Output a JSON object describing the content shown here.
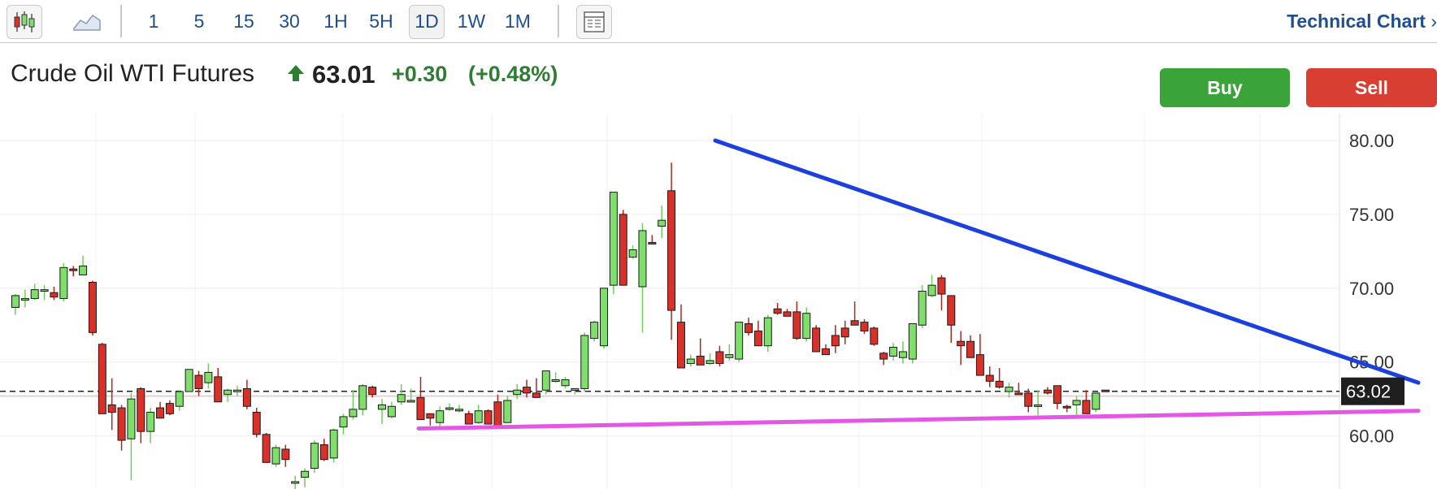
{
  "toolbar": {
    "timeframes": [
      "1",
      "5",
      "15",
      "30",
      "1H",
      "5H",
      "1D",
      "1W",
      "1M"
    ],
    "active_timeframe": "1D",
    "technical_chart_label": "Technical Chart",
    "chevron": "›",
    "icons": [
      "candlestick-icon",
      "area-chart-icon",
      "layout-icon"
    ]
  },
  "instrument": {
    "name": "Crude Oil WTI Futures",
    "direction": "up-arrow-icon",
    "price": "63.01",
    "change": "+0.30",
    "change_pct": "(+0.48%)"
  },
  "actions": {
    "buy_label": "Buy",
    "sell_label": "Sell"
  },
  "colors": {
    "up": "#7fdf6a",
    "down": "#d8312a",
    "buy": "#3aa339",
    "sell": "#d93e32",
    "link": "#1f4f91",
    "resistance": "#1c3fe0",
    "support": "#e456e6"
  },
  "chart_data": {
    "type": "candlestick",
    "title": "Crude Oil WTI Futures",
    "ylim": [
      57.5,
      80.6
    ],
    "yticks": [
      "80.00",
      "75.00",
      "70.00",
      "65.00",
      "60.00"
    ],
    "last_price_label": "63.02",
    "last_price": 63.02,
    "ohlc": [
      [
        68.7,
        69.6,
        68.2,
        69.5
      ],
      [
        69.3,
        69.9,
        68.7,
        69.3
      ],
      [
        69.3,
        70.3,
        69.2,
        69.9
      ],
      [
        69.8,
        70.2,
        69.2,
        69.9
      ],
      [
        69.7,
        70.1,
        69.2,
        69.4
      ],
      [
        69.3,
        71.7,
        69.1,
        71.4
      ],
      [
        71.3,
        71.5,
        70.8,
        71.2
      ],
      [
        70.9,
        72.2,
        70.9,
        71.5
      ],
      [
        70.4,
        70.5,
        66.8,
        67.0
      ],
      [
        66.2,
        66.3,
        61.7,
        61.5
      ],
      [
        62.1,
        63.9,
        60.4,
        61.6
      ],
      [
        61.9,
        62.1,
        59.0,
        59.7
      ],
      [
        59.8,
        62.9,
        57.0,
        62.5
      ],
      [
        63.2,
        63.3,
        59.5,
        60.3
      ],
      [
        60.3,
        61.9,
        59.5,
        61.6
      ],
      [
        61.9,
        62.3,
        61.2,
        61.2
      ],
      [
        62.2,
        62.4,
        61.4,
        61.5
      ],
      [
        62.0,
        63.1,
        61.7,
        63.0
      ],
      [
        63.0,
        64.4,
        63.0,
        64.5
      ],
      [
        64.1,
        64.4,
        62.7,
        63.2
      ],
      [
        63.6,
        64.9,
        63.2,
        64.3
      ],
      [
        64.0,
        64.6,
        62.3,
        62.3
      ],
      [
        62.8,
        63.2,
        62.3,
        63.1
      ],
      [
        63.0,
        63.4,
        62.7,
        63.1
      ],
      [
        63.2,
        63.8,
        61.8,
        62.0
      ],
      [
        61.6,
        61.9,
        59.9,
        60.1
      ],
      [
        60.1,
        60.2,
        58.3,
        58.2
      ],
      [
        58.1,
        59.4,
        57.9,
        59.2
      ],
      [
        59.1,
        59.4,
        57.9,
        58.4
      ],
      [
        56.8,
        57.3,
        56.3,
        56.9
      ],
      [
        57.2,
        57.8,
        56.5,
        57.6
      ],
      [
        57.8,
        59.7,
        57.5,
        59.5
      ],
      [
        59.4,
        59.8,
        58.3,
        58.4
      ],
      [
        58.5,
        60.5,
        58.2,
        60.4
      ],
      [
        60.6,
        61.5,
        60.1,
        61.3
      ],
      [
        61.3,
        63.1,
        61.1,
        61.8
      ],
      [
        61.8,
        63.5,
        61.4,
        63.4
      ],
      [
        63.3,
        63.4,
        62.6,
        62.8
      ],
      [
        61.8,
        62.5,
        60.8,
        62.1
      ],
      [
        61.3,
        62.3,
        61.2,
        62.0
      ],
      [
        62.3,
        63.5,
        62.1,
        62.8
      ],
      [
        62.4,
        63.2,
        62.3,
        62.4
      ],
      [
        62.6,
        64.0,
        61.7,
        61.1
      ],
      [
        61.5,
        61.5,
        60.7,
        61.2
      ],
      [
        60.9,
        62.0,
        60.6,
        61.7
      ],
      [
        61.8,
        62.2,
        61.7,
        61.9
      ],
      [
        61.8,
        62.1,
        61.6,
        61.8
      ],
      [
        61.5,
        61.7,
        60.8,
        60.8
      ],
      [
        60.9,
        62.1,
        60.8,
        61.7
      ],
      [
        61.7,
        61.8,
        60.9,
        60.8
      ],
      [
        62.3,
        62.8,
        60.5,
        60.7
      ],
      [
        60.9,
        62.7,
        60.9,
        62.4
      ],
      [
        62.8,
        63.5,
        62.5,
        63.1
      ],
      [
        63.3,
        63.8,
        62.6,
        62.9
      ],
      [
        62.9,
        63.9,
        62.6,
        62.6
      ],
      [
        63.1,
        64.3,
        62.8,
        64.4
      ],
      [
        63.7,
        64.3,
        63.6,
        63.8
      ],
      [
        63.4,
        64.0,
        63.2,
        63.8
      ],
      [
        63.1,
        63.2,
        62.8,
        63.2
      ],
      [
        63.2,
        67.0,
        63.0,
        66.8
      ],
      [
        66.6,
        67.8,
        66.4,
        67.7
      ],
      [
        66.1,
        69.3,
        65.9,
        70.0
      ],
      [
        70.2,
        74.3,
        69.6,
        76.5
      ],
      [
        75.0,
        75.3,
        71.0,
        70.2
      ],
      [
        72.1,
        72.9,
        72.0,
        72.6
      ],
      [
        70.1,
        74.4,
        67.0,
        73.9
      ],
      [
        73.1,
        73.6,
        73.1,
        73.0
      ],
      [
        74.2,
        75.6,
        73.4,
        74.6
      ],
      [
        76.6,
        78.5,
        66.5,
        68.5
      ],
      [
        67.7,
        68.9,
        65.0,
        64.6
      ],
      [
        64.9,
        65.5,
        64.7,
        65.2
      ],
      [
        65.4,
        66.6,
        64.8,
        64.8
      ],
      [
        64.9,
        65.6,
        64.8,
        65.1
      ],
      [
        65.7,
        66.1,
        64.7,
        64.9
      ],
      [
        65.3,
        66.2,
        65.1,
        65.5
      ],
      [
        65.2,
        67.6,
        65.0,
        67.7
      ],
      [
        67.6,
        68.0,
        66.8,
        67.0
      ],
      [
        67.1,
        67.8,
        66.5,
        66.1
      ],
      [
        66.1,
        68.2,
        65.7,
        68.0
      ],
      [
        68.6,
        69.0,
        68.2,
        68.3
      ],
      [
        68.4,
        68.6,
        68.2,
        68.1
      ],
      [
        68.4,
        69.1,
        66.5,
        66.6
      ],
      [
        66.6,
        68.7,
        66.4,
        68.3
      ],
      [
        67.3,
        67.5,
        66.0,
        65.7
      ],
      [
        65.9,
        66.2,
        65.6,
        65.5
      ],
      [
        66.8,
        67.5,
        65.6,
        66.1
      ],
      [
        67.3,
        67.8,
        66.2,
        66.7
      ],
      [
        67.8,
        69.1,
        67.5,
        67.5
      ],
      [
        67.7,
        67.9,
        66.9,
        67.1
      ],
      [
        67.3,
        67.4,
        66.1,
        66.2
      ],
      [
        65.6,
        65.7,
        64.8,
        65.2
      ],
      [
        65.4,
        66.3,
        65.1,
        66.0
      ],
      [
        65.3,
        66.4,
        64.9,
        65.7
      ],
      [
        65.2,
        67.1,
        64.9,
        67.6
      ],
      [
        67.5,
        70.2,
        67.3,
        69.8
      ],
      [
        69.5,
        70.9,
        69.4,
        70.2
      ],
      [
        70.7,
        70.9,
        68.5,
        69.6
      ],
      [
        69.5,
        69.5,
        66.3,
        67.5
      ],
      [
        66.4,
        67.1,
        64.8,
        66.1
      ],
      [
        66.4,
        66.8,
        65.7,
        65.3
      ],
      [
        65.5,
        66.9,
        65.2,
        64.1
      ],
      [
        64.1,
        64.7,
        63.3,
        63.7
      ],
      [
        63.7,
        64.6,
        63.2,
        63.3
      ],
      [
        63.0,
        63.6,
        62.6,
        63.3
      ],
      [
        62.9,
        63.6,
        62.8,
        62.8
      ],
      [
        62.9,
        63.2,
        61.6,
        62.0
      ],
      [
        62.1,
        63.1,
        61.4,
        62.1
      ],
      [
        63.1,
        63.3,
        62.8,
        62.9
      ],
      [
        63.4,
        63.2,
        61.8,
        62.2
      ],
      [
        62.0,
        62.1,
        61.6,
        61.9
      ],
      [
        62.1,
        62.7,
        61.4,
        62.4
      ],
      [
        62.4,
        63.1,
        61.6,
        61.5
      ],
      [
        61.8,
        62.9,
        61.6,
        62.9
      ],
      [
        63.1,
        63.1,
        63.0,
        63.02
      ]
    ]
  }
}
